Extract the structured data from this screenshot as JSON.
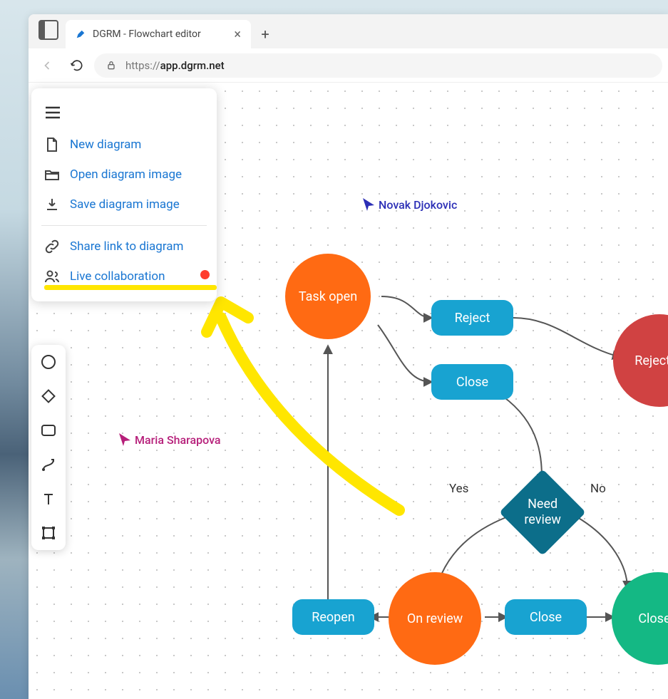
{
  "browser": {
    "tab_title": "DGRM - Flowchart editor",
    "url_prefix": "https://",
    "url_host": "app.dgrm.net"
  },
  "menu": {
    "items": [
      {
        "label": "New diagram"
      },
      {
        "label": "Open diagram image"
      },
      {
        "label": "Save diagram image"
      },
      {
        "label": "Share link to diagram"
      },
      {
        "label": "Live collaboration"
      }
    ]
  },
  "collaborators": {
    "c0": {
      "name": "Novak Djokovic",
      "color": "#2c2fb6"
    },
    "c1": {
      "name": "Maria Sharapova",
      "color": "#b61f7a"
    }
  },
  "flowchart": {
    "nodes": {
      "task_open": {
        "label": "Task open",
        "color": "#ff6a13"
      },
      "reject_btn": {
        "label": "Reject",
        "color": "#18a3d1"
      },
      "close_btn1": {
        "label": "Close",
        "color": "#18a3d1"
      },
      "rejected": {
        "label": "Rejected",
        "color": "#d04242"
      },
      "need_review": {
        "label": "Need\nreview",
        "color": "#0c6e8a"
      },
      "reopen_btn": {
        "label": "Reopen",
        "color": "#18a3d1"
      },
      "on_review": {
        "label": "On review",
        "color": "#ff6a13"
      },
      "close_btn2": {
        "label": "Close",
        "color": "#18a3d1"
      },
      "closed": {
        "label": "Closed",
        "color": "#14b884"
      }
    },
    "labels": {
      "yes": "Yes",
      "no": "No"
    }
  }
}
